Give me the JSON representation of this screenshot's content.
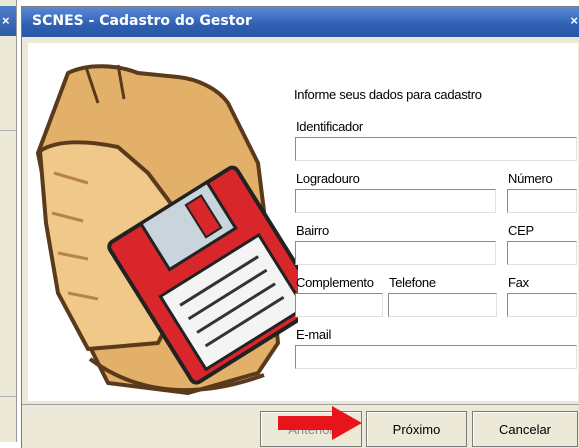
{
  "background_window": {
    "close_icon": "close-icon"
  },
  "dialog": {
    "title": "SCNES - Cadastro do Gestor",
    "close_icon": "close-icon",
    "intro": "Informe seus dados para cadastro",
    "fields": {
      "identificador": {
        "label": "Identificador",
        "value": ""
      },
      "logradouro": {
        "label": "Logradouro",
        "value": ""
      },
      "numero": {
        "label": "Número",
        "value": ""
      },
      "bairro": {
        "label": "Bairro",
        "value": ""
      },
      "cep": {
        "label": "CEP",
        "value": ""
      },
      "complemento": {
        "label": "Complemento",
        "value": ""
      },
      "telefone": {
        "label": "Telefone",
        "value": ""
      },
      "fax": {
        "label": "Fax",
        "value": ""
      },
      "email": {
        "label": "E-mail",
        "value": ""
      }
    },
    "buttons": {
      "anterior": "Anterior",
      "proximo": "Próximo",
      "cancelar": "Cancelar"
    },
    "illustration": "folder-floppy-disk-icon",
    "annotation": "red-arrow-icon"
  },
  "colors": {
    "titlebar": "#2f5fb3",
    "dialog_bg": "#ece9d8",
    "arrow": "#e8141b",
    "floppy": "#d9262b",
    "folder": "#e2b574"
  }
}
